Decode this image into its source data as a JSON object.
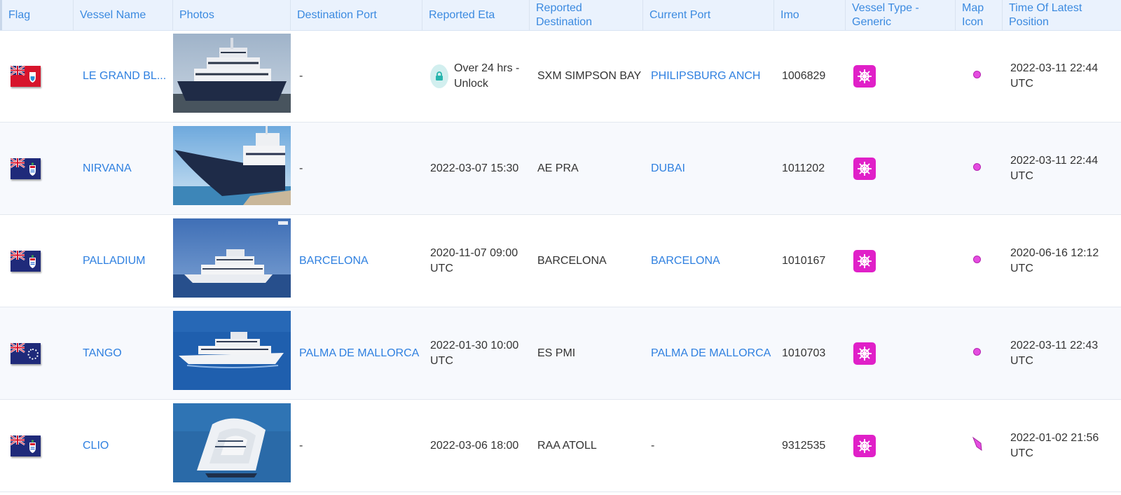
{
  "columns": [
    "Flag",
    "Vessel Name",
    "Photos",
    "Destination Port",
    "Reported Eta",
    "Reported Destination",
    "Current Port",
    "Imo",
    "Vessel Type - Generic",
    "Map Icon",
    "Time Of Latest Position"
  ],
  "rows": [
    {
      "flag": "bermuda-flag-icon",
      "vessel_name": "LE GRAND BL...",
      "photo": "superyacht-harbor-photo",
      "destination_port": "-",
      "reported_eta": "Over 24 hrs - Unlock",
      "eta_locked": true,
      "reported_destination": "SXM SIMPSON BAY",
      "current_port": "PHILIPSBURG ANCH",
      "imo": "1006829",
      "vessel_type_icon": "pleasure-craft-icon",
      "map_icon": "dot",
      "time_latest_position": "2022-03-11 22:44 UTC"
    },
    {
      "flag": "cayman-islands-flag-icon",
      "vessel_name": "NIRVANA",
      "photo": "yacht-bow-photo",
      "destination_port": "-",
      "reported_eta": "2022-03-07 15:30",
      "eta_locked": false,
      "reported_destination": "AE PRA",
      "current_port": "DUBAI",
      "imo": "1011202",
      "vessel_type_icon": "pleasure-craft-icon",
      "map_icon": "dot",
      "time_latest_position": "2022-03-11 22:44 UTC"
    },
    {
      "flag": "cayman-islands-flag-icon",
      "vessel_name": "PALLADIUM",
      "photo": "yacht-at-sea-photo",
      "destination_port": "BARCELONA",
      "reported_eta": "2020-11-07 09:00 UTC",
      "eta_locked": false,
      "reported_destination": "BARCELONA",
      "current_port": "BARCELONA",
      "imo": "1010167",
      "vessel_type_icon": "pleasure-craft-icon",
      "map_icon": "dot",
      "time_latest_position": "2020-06-16 12:12 UTC"
    },
    {
      "flag": "cook-islands-flag-icon",
      "vessel_name": "TANGO",
      "photo": "yacht-blue-sea-photo",
      "destination_port": "PALMA DE MALLORCA",
      "reported_eta": "2022-01-30 10:00 UTC",
      "eta_locked": false,
      "reported_destination": "ES PMI",
      "current_port": "PALMA DE MALLORCA",
      "imo": "1010703",
      "vessel_type_icon": "pleasure-craft-icon",
      "map_icon": "dot",
      "time_latest_position": "2022-03-11 22:43 UTC"
    },
    {
      "flag": "cayman-islands-flag-icon",
      "vessel_name": "CLIO",
      "photo": "yacht-aerial-photo",
      "destination_port": "-",
      "reported_eta": "2022-03-06 18:00",
      "eta_locked": false,
      "reported_destination": "RAA ATOLL",
      "current_port": "-",
      "imo": "9312535",
      "vessel_type_icon": "pleasure-craft-icon",
      "map_icon": "arrow",
      "time_latest_position": "2022-01-02 21:56 UTC"
    }
  ],
  "colors": {
    "header_bg": "#eaf2fd",
    "link": "#2f80e0",
    "vessel_type_badge": "#e020c8",
    "map_dot": "#e54ce0"
  }
}
